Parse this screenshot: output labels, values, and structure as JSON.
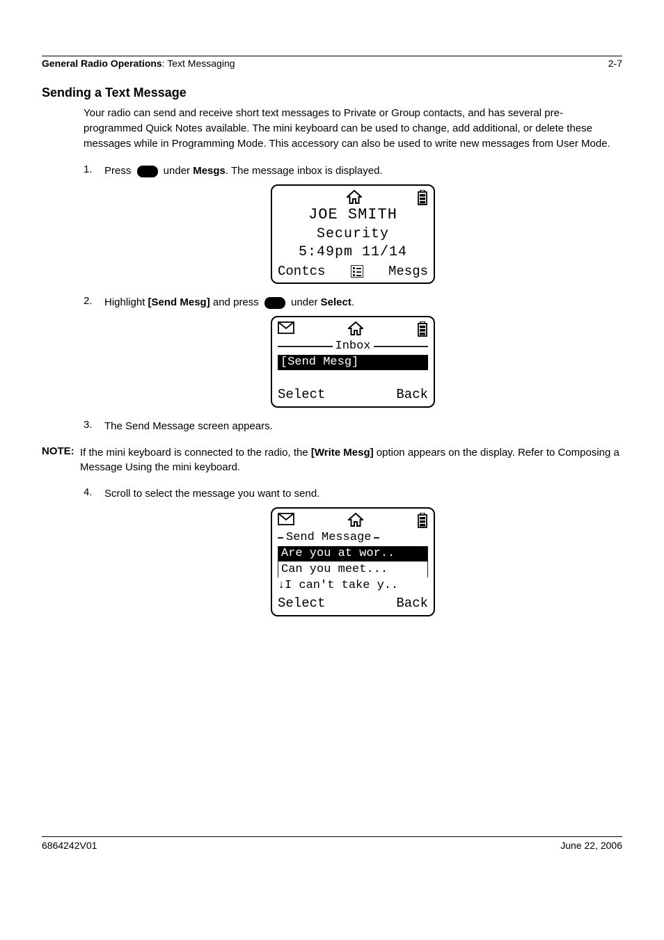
{
  "running_head": {
    "bold": "General Radio Operations",
    "rest": ": Text Messaging",
    "page": "2-7"
  },
  "section_title": "Sending a Text Message",
  "intro": "Your radio can send and receive short text messages to Private or Group contacts, and has several pre-programmed Quick Notes available. The mini keyboard can be used to change, add additional, or delete these messages while in Programming Mode. This accessory can also be used to write new messages from User Mode.",
  "steps": {
    "s1_pre": "Press ",
    "s1_post_a": " under ",
    "s1_word": "Mesgs",
    "s1_post_b": ". The message inbox is displayed.",
    "s2_pre": "Highlight ",
    "s2_word": "[Send Mesg]",
    "s2_mid": " and press ",
    "s2_post_a": " under ",
    "s2_word2": "Select",
    "s2_post_b": ".",
    "s3": "The Send Message screen appears.",
    "s4": "Scroll to select the message you want to send."
  },
  "note": {
    "label": "NOTE:",
    "text_a": "If the mini keyboard is connected to the radio, the ",
    "text_bold": "[Write Mesg]",
    "text_b": " option appears on the display. Refer to Composing a Message Using the mini keyboard."
  },
  "lcd1": {
    "l1": "JOE SMITH",
    "l2": "Security",
    "l3": "5:49pm  11/14",
    "left": "Contcs",
    "right": "Mesgs"
  },
  "lcd2": {
    "title": "Inbox",
    "item": "[Send Mesg]",
    "left": "Select",
    "right": "Back"
  },
  "lcd3": {
    "title": "Send Message",
    "item1": "Are you at wor..",
    "item2": "Can you meet...",
    "item3": "I can't take y..",
    "left": "Select",
    "right": "Back"
  },
  "footer": {
    "left": "6864242V01",
    "right": "June 22, 2006"
  }
}
